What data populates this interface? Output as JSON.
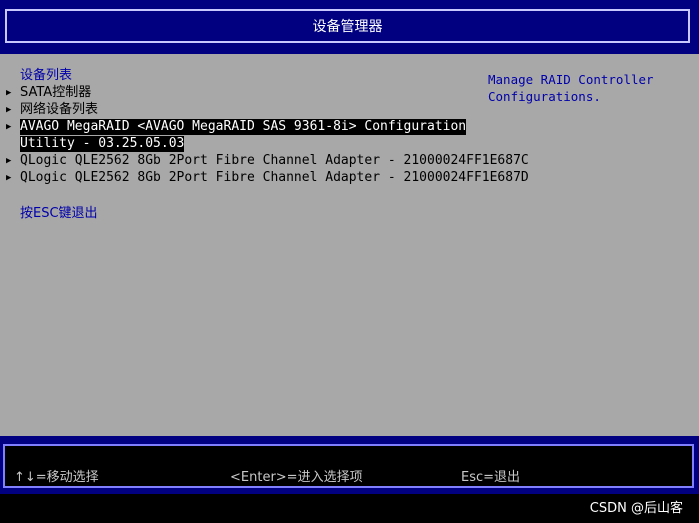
{
  "header": {
    "title": "设备管理器"
  },
  "menu": {
    "section_title": "设备列表",
    "items": [
      {
        "label": "SATA控制器"
      },
      {
        "label": "网络设备列表"
      },
      {
        "label_line1": "AVAGO MegaRAID <AVAGO MegaRAID SAS 9361-8i> Configuration",
        "label_line2": "Utility - 03.25.05.03"
      },
      {
        "label": "QLogic QLE2562 8Gb 2Port Fibre Channel Adapter - 21000024FF1E687C"
      },
      {
        "label": "QLogic QLE2562 8Gb 2Port Fibre Channel Adapter - 21000024FF1E687D"
      }
    ],
    "exit_hint": "按ESC键退出"
  },
  "help": {
    "text": "Manage RAID Controller\nConfigurations."
  },
  "footer": {
    "move": "↑↓=移动选择",
    "enter": "<Enter>=进入选择项",
    "esc": "Esc=退出"
  },
  "watermark": "CSDN @后山客",
  "colors": {
    "header_bg": "#000080",
    "panel_bg": "#a8a8a8",
    "highlight_text": "#0000aa",
    "selected_bg": "#000000"
  }
}
